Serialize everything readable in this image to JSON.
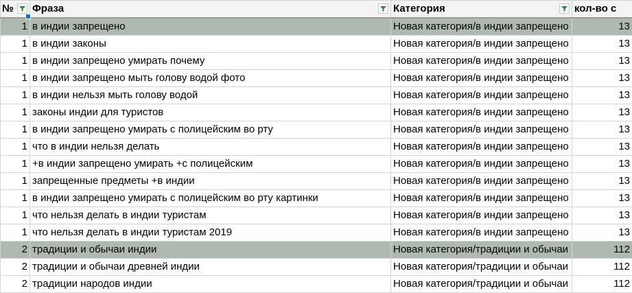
{
  "columns": {
    "num": "№",
    "phrase": "Фраза",
    "category": "Категория",
    "count": "кол-во с"
  },
  "icons": {
    "filter": "filter-icon"
  },
  "colors": {
    "highlight_row": "#aebaaf",
    "header_bg": "#f3f3f3",
    "filter_green": "#2e8b3a"
  },
  "rows": [
    {
      "num": "1",
      "phrase": "в индии запрещено",
      "category": "Новая категория/в индии запрещено",
      "count": "13",
      "highlight": true
    },
    {
      "num": "1",
      "phrase": "в индии законы",
      "category": "Новая категория/в индии запрещено",
      "count": "13"
    },
    {
      "num": "1",
      "phrase": "в индии запрещено умирать почему",
      "category": "Новая категория/в индии запрещено",
      "count": "13"
    },
    {
      "num": "1",
      "phrase": "в индии запрещено мыть голову водой фото",
      "category": "Новая категория/в индии запрещено",
      "count": "13"
    },
    {
      "num": "1",
      "phrase": "в индии нельзя мыть голову водой",
      "category": "Новая категория/в индии запрещено",
      "count": "13"
    },
    {
      "num": "1",
      "phrase": "законы индии для туристов",
      "category": "Новая категория/в индии запрещено",
      "count": "13"
    },
    {
      "num": "1",
      "phrase": "в индии запрещено умирать с полицейским во рту",
      "category": "Новая категория/в индии запрещено",
      "count": "13"
    },
    {
      "num": "1",
      "phrase": "что в индии нельзя делать",
      "category": "Новая категория/в индии запрещено",
      "count": "13"
    },
    {
      "num": "1",
      "phrase": "+в индии запрещено умирать +с полицейским",
      "category": "Новая категория/в индии запрещено",
      "count": "13"
    },
    {
      "num": "1",
      "phrase": "запрещенные предметы +в индии",
      "category": "Новая категория/в индии запрещено",
      "count": "13"
    },
    {
      "num": "1",
      "phrase": "в индии запрещено умирать с полицейским во рту картинки",
      "category": "Новая категория/в индии запрещено",
      "count": "13"
    },
    {
      "num": "1",
      "phrase": "что нельзя делать в индии туристам",
      "category": "Новая категория/в индии запрещено",
      "count": "13"
    },
    {
      "num": "1",
      "phrase": "что нельзя делать в индии туристам 2019",
      "category": "Новая категория/в индии запрещено",
      "count": "13"
    },
    {
      "num": "2",
      "phrase": "традиции и обычаи индии",
      "category": "Новая категория/традиции и обычаи индии",
      "count": "112",
      "highlight": true
    },
    {
      "num": "2",
      "phrase": "традиции и обычаи древней индии",
      "category": "Новая категория/традиции и обычаи индии",
      "count": "112"
    },
    {
      "num": "2",
      "phrase": "традиции народов индии",
      "category": "Новая категория/традиции и обычаи индии",
      "count": "112"
    }
  ]
}
